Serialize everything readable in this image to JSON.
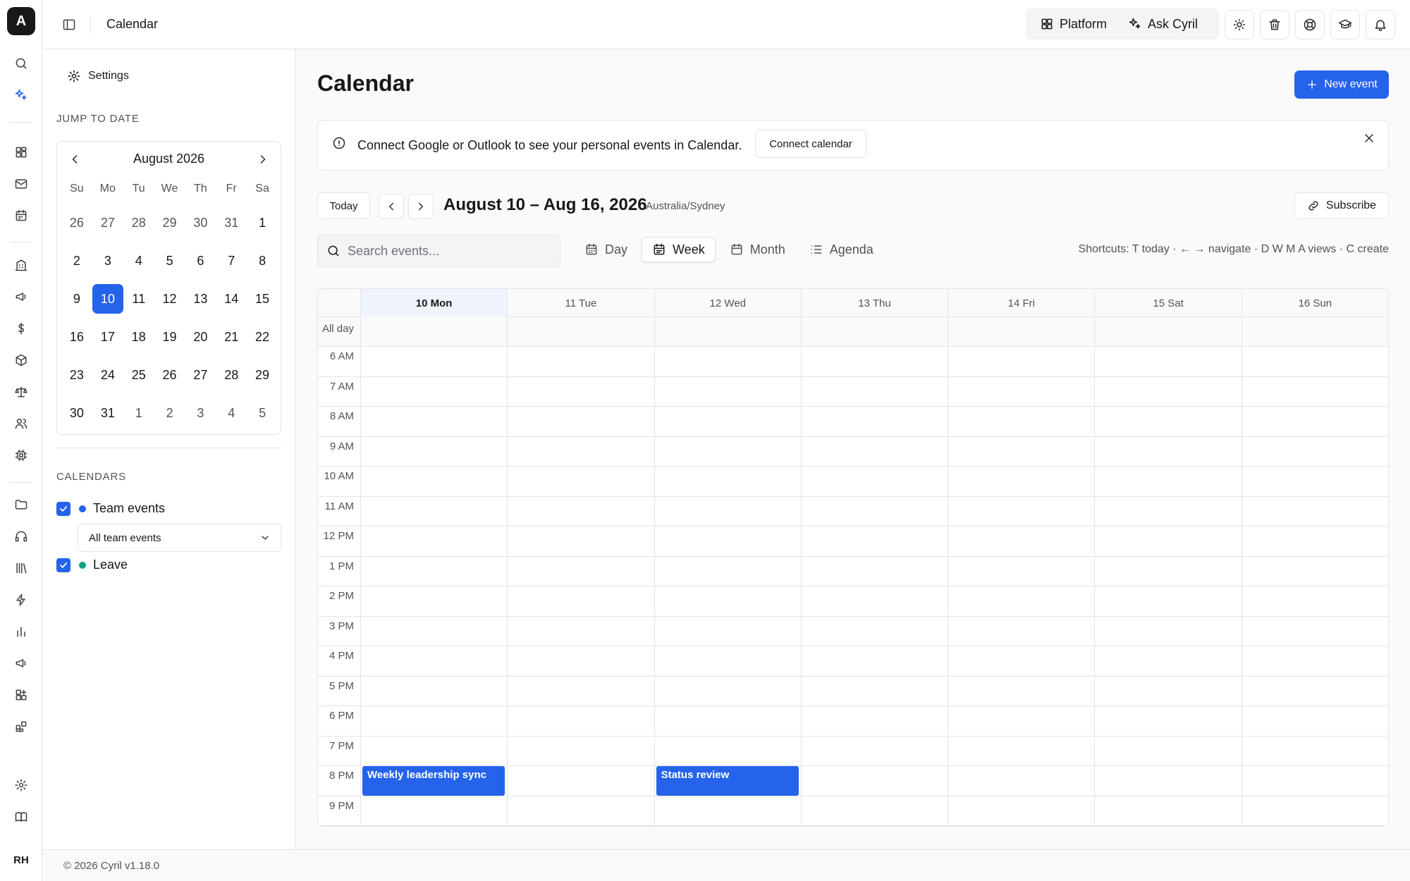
{
  "app": {
    "logo_letter": "A",
    "user_initials": "RH"
  },
  "topbar": {
    "title": "Calendar",
    "platform_label": "Platform",
    "ask_label": "Ask Cyril"
  },
  "panel": {
    "settings_label": "Settings",
    "jump_label": "JUMP TO DATE",
    "mini_calendar": {
      "month_label": "August 2026",
      "weekdays": [
        "Su",
        "Mo",
        "Tu",
        "We",
        "Th",
        "Fr",
        "Sa"
      ],
      "days": [
        {
          "d": "26",
          "out": true
        },
        {
          "d": "27",
          "out": true
        },
        {
          "d": "28",
          "out": true
        },
        {
          "d": "29",
          "out": true
        },
        {
          "d": "30",
          "out": true
        },
        {
          "d": "31",
          "out": true
        },
        {
          "d": "1"
        },
        {
          "d": "2"
        },
        {
          "d": "3"
        },
        {
          "d": "4"
        },
        {
          "d": "5"
        },
        {
          "d": "6"
        },
        {
          "d": "7"
        },
        {
          "d": "8"
        },
        {
          "d": "9"
        },
        {
          "d": "10",
          "selected": true
        },
        {
          "d": "11"
        },
        {
          "d": "12"
        },
        {
          "d": "13"
        },
        {
          "d": "14"
        },
        {
          "d": "15"
        },
        {
          "d": "16"
        },
        {
          "d": "17"
        },
        {
          "d": "18"
        },
        {
          "d": "19"
        },
        {
          "d": "20"
        },
        {
          "d": "21"
        },
        {
          "d": "22"
        },
        {
          "d": "23"
        },
        {
          "d": "24"
        },
        {
          "d": "25"
        },
        {
          "d": "26"
        },
        {
          "d": "27"
        },
        {
          "d": "28"
        },
        {
          "d": "29"
        },
        {
          "d": "30"
        },
        {
          "d": "31"
        },
        {
          "d": "1",
          "out": true
        },
        {
          "d": "2",
          "out": true
        },
        {
          "d": "3",
          "out": true
        },
        {
          "d": "4",
          "out": true
        },
        {
          "d": "5",
          "out": true
        }
      ]
    },
    "calendars_label": "CALENDARS",
    "calendars": [
      {
        "name": "Team events",
        "checked": true,
        "color": "#2563eb"
      },
      {
        "name": "Leave",
        "checked": true,
        "color": "#14a085"
      }
    ],
    "team_filter": "All team events"
  },
  "main": {
    "title": "Calendar",
    "new_event_label": "New event",
    "banner": {
      "text": "Connect Google or Outlook to see your personal events in Calendar.",
      "button_label": "Connect calendar"
    },
    "today_label": "Today",
    "range_title": "August 10 – Aug 16, 2026",
    "timezone": "Australia/Sydney",
    "subscribe_label": "Subscribe",
    "search_placeholder": "Search events...",
    "views": [
      {
        "label": "Day",
        "icon": "calendar-day-icon",
        "active": false
      },
      {
        "label": "Week",
        "icon": "calendar-week-icon",
        "active": true
      },
      {
        "label": "Month",
        "icon": "calendar-month-icon",
        "active": false
      },
      {
        "label": "Agenda",
        "icon": "list-icon",
        "active": false
      }
    ],
    "shortcuts": "Shortcuts: T today · ← → navigate · D W M A views · C create"
  },
  "week": {
    "days": [
      {
        "label": "10 Mon",
        "today": true
      },
      {
        "label": "11 Tue"
      },
      {
        "label": "12 Wed"
      },
      {
        "label": "13 Thu"
      },
      {
        "label": "14 Fri"
      },
      {
        "label": "15 Sat"
      },
      {
        "label": "16 Sun"
      }
    ],
    "all_day_label": "All day",
    "hours": [
      "6 AM",
      "7 AM",
      "8 AM",
      "9 AM",
      "10 AM",
      "11 AM",
      "12 PM",
      "1 PM",
      "2 PM",
      "3 PM",
      "4 PM",
      "5 PM",
      "6 PM",
      "7 PM",
      "8 PM",
      "9 PM"
    ],
    "events": [
      {
        "title": "Weekly leadership sync",
        "day": 0,
        "start_hour": "8 PM"
      },
      {
        "title": "Status review",
        "day": 2,
        "start_hour": "8 PM"
      }
    ]
  },
  "footer": {
    "text": "© 2026 Cyril v1.18.0"
  },
  "colors": {
    "accent": "#2563eb",
    "leave": "#14a085"
  }
}
